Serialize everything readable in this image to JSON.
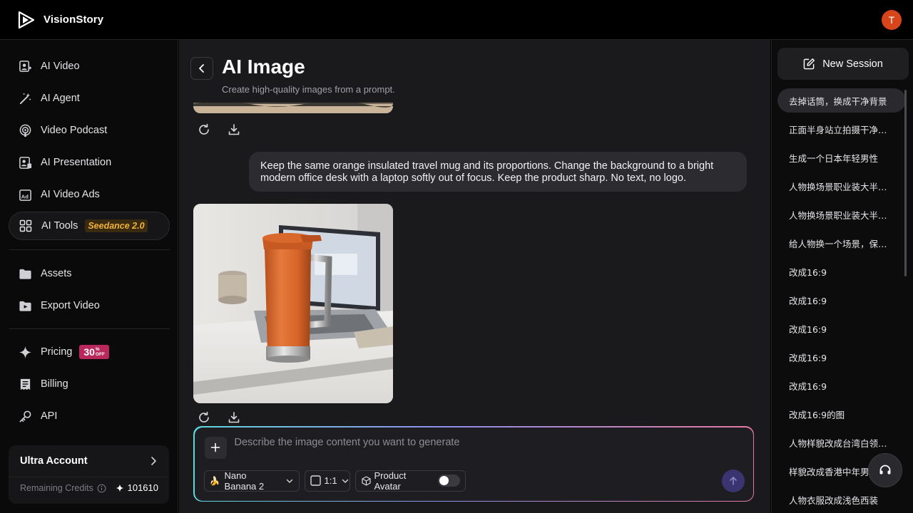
{
  "app": {
    "name": "VisionStory",
    "user_initial": "T"
  },
  "sidebar": {
    "items": [
      {
        "label": "AI Video",
        "icon": "person-video-icon"
      },
      {
        "label": "AI Agent",
        "icon": "magic-wand-icon"
      },
      {
        "label": "Video Podcast",
        "icon": "podcast-icon"
      },
      {
        "label": "AI Presentation",
        "icon": "presentation-icon"
      },
      {
        "label": "AI Video Ads",
        "icon": "ad-icon"
      },
      {
        "label": "AI Tools",
        "icon": "grid-icon",
        "badge": "Seedance 2.0",
        "active": true
      },
      {
        "label": "Assets",
        "icon": "folder-icon"
      },
      {
        "label": "Export Video",
        "icon": "export-folder-icon"
      },
      {
        "label": "Pricing",
        "icon": "sparkle-icon",
        "badge": "30",
        "badge_small": "%\nOFF"
      },
      {
        "label": "Billing",
        "icon": "receipt-icon"
      },
      {
        "label": "API",
        "icon": "key-icon"
      }
    ],
    "account": {
      "title": "Ultra Account",
      "credits_label": "Remaining Credits",
      "credits_value": "101610"
    }
  },
  "main": {
    "title": "AI Image",
    "subtitle": "Create high-quality images from a prompt.",
    "user_message": "Keep the same orange insulated travel mug and its proportions. Change the background to a bright modern office desk with a laptop softly out of focus. Keep the product sharp. No text, no logo.",
    "prompt": {
      "placeholder": "Describe the image content you want to generate",
      "value": "",
      "model": "Nano Banana 2",
      "ratio": "1:1",
      "product_avatar_label": "Product Avatar",
      "product_avatar_on": false
    }
  },
  "right_panel": {
    "new_session_label": "New Session",
    "sessions": [
      "去掉话筒，换成干净背景",
      "正面半身站立拍摄干净背景",
      "生成一个日本年轻男性",
      "人物换场景职业装大半身照",
      "人物换场景职业装大半身照",
      "给人物换一个场景，保持人物",
      "改成16:9",
      "改成16:9",
      "改成16:9",
      "改成16:9",
      "改成16:9",
      "改成16:9的图",
      "人物样貌改成台湾白领，保持",
      "样貌改成香港中年男性",
      "人物衣服改成浅色西装"
    ]
  },
  "colors": {
    "accent_gradient": [
      "#5fd6e0",
      "#8f8ee8",
      "#e3799f"
    ],
    "avatar": "#d9451a",
    "seedance_badge": "#f0b23a",
    "pricing_badge": "#b8285b"
  }
}
